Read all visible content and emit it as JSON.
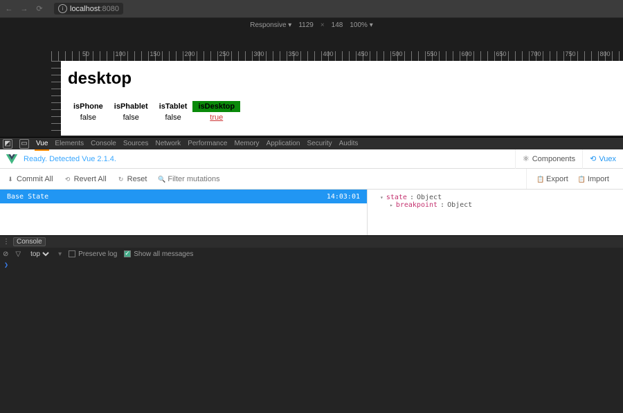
{
  "browser": {
    "url_host": "localhost",
    "url_port": ":8080"
  },
  "device_toolbar": {
    "mode": "Responsive ▾",
    "width": "1129",
    "height": "148",
    "zoom": "100% ▾"
  },
  "ruler_ticks": [
    "50",
    "100",
    "150",
    "200",
    "250",
    "300",
    "350",
    "400",
    "450",
    "500",
    "550",
    "600",
    "650",
    "700",
    "750",
    "800"
  ],
  "page": {
    "heading": "desktop",
    "columns": [
      {
        "label": "isPhone",
        "value": "false",
        "active": false
      },
      {
        "label": "isPhablet",
        "value": "false",
        "active": false
      },
      {
        "label": "isTablet",
        "value": "false",
        "active": false
      },
      {
        "label": "isDesktop",
        "value": "true",
        "active": true
      }
    ]
  },
  "devtools": {
    "tabs": [
      "Vue",
      "Elements",
      "Console",
      "Sources",
      "Network",
      "Performance",
      "Memory",
      "Application",
      "Security",
      "Audits"
    ],
    "active_tab": "Vue"
  },
  "vue": {
    "status": "Ready. Detected Vue 2.1.4.",
    "panels": {
      "components": "Components",
      "vuex": "Vuex"
    },
    "toolbar": {
      "commit_all": "Commit All",
      "revert_all": "Revert All",
      "reset": "Reset",
      "filter_placeholder": "Filter mutations",
      "export": "Export",
      "import": "Import"
    },
    "base_state": {
      "label": "Base State",
      "time": "14:03:01"
    },
    "inspector": {
      "root_key": "state",
      "root_type": "Object",
      "child_key": "breakpoint",
      "child_type": "Object"
    }
  },
  "console": {
    "drawer_label": "Console",
    "context": "top",
    "preserve_log_label": "Preserve log",
    "show_all_label": "Show all messages",
    "preserve_log": false,
    "show_all": true,
    "prompt": "❯"
  }
}
